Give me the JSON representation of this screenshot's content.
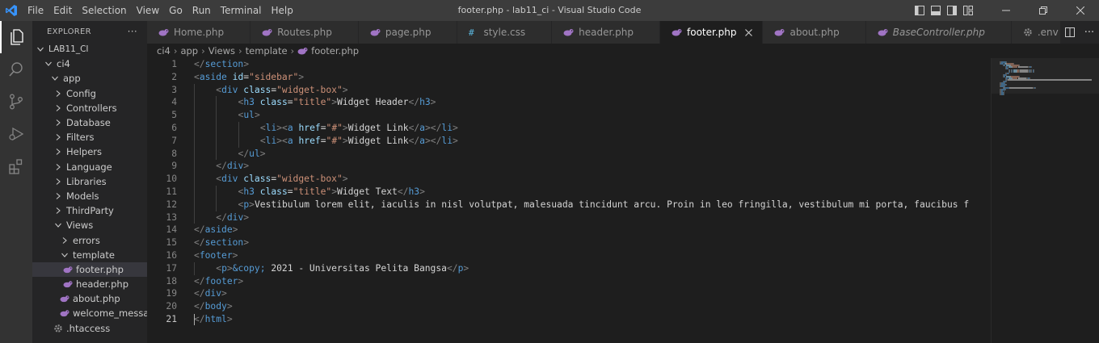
{
  "window": {
    "title": "footer.php - lab11_ci - Visual Studio Code",
    "menu": [
      "File",
      "Edit",
      "Selection",
      "View",
      "Go",
      "Run",
      "Terminal",
      "Help"
    ]
  },
  "explorer": {
    "header": "EXPLORER",
    "more": "···",
    "tree": [
      {
        "label": "LAB11_CI",
        "depth": 0,
        "kind": "folder-open"
      },
      {
        "label": "ci4",
        "depth": 1,
        "kind": "folder-open"
      },
      {
        "label": "app",
        "depth": 2,
        "kind": "folder-open"
      },
      {
        "label": "Config",
        "depth": 3,
        "kind": "folder"
      },
      {
        "label": "Controllers",
        "depth": 3,
        "kind": "folder"
      },
      {
        "label": "Database",
        "depth": 3,
        "kind": "folder"
      },
      {
        "label": "Filters",
        "depth": 3,
        "kind": "folder"
      },
      {
        "label": "Helpers",
        "depth": 3,
        "kind": "folder"
      },
      {
        "label": "Language",
        "depth": 3,
        "kind": "folder"
      },
      {
        "label": "Libraries",
        "depth": 3,
        "kind": "folder"
      },
      {
        "label": "Models",
        "depth": 3,
        "kind": "folder"
      },
      {
        "label": "ThirdParty",
        "depth": 3,
        "kind": "folder"
      },
      {
        "label": "Views",
        "depth": 3,
        "kind": "folder-open"
      },
      {
        "label": "errors",
        "depth": 4,
        "kind": "folder"
      },
      {
        "label": "template",
        "depth": 4,
        "kind": "folder-open"
      },
      {
        "label": "footer.php",
        "depth": 5,
        "kind": "php",
        "active": true
      },
      {
        "label": "header.php",
        "depth": 5,
        "kind": "php"
      },
      {
        "label": "about.php",
        "depth": 4,
        "kind": "php"
      },
      {
        "label": "welcome_messa...",
        "depth": 4,
        "kind": "php"
      },
      {
        "label": ".htaccess",
        "depth": 3,
        "kind": "gear"
      }
    ]
  },
  "tabs": [
    {
      "label": "Home.php",
      "icon": "php-icon",
      "active": false,
      "italic": false
    },
    {
      "label": "Routes.php",
      "icon": "php-icon",
      "active": false,
      "italic": false
    },
    {
      "label": "page.php",
      "icon": "php-icon",
      "active": false,
      "italic": false
    },
    {
      "label": "style.css",
      "icon": "css-icon",
      "active": false,
      "italic": false
    },
    {
      "label": "header.php",
      "icon": "php-icon",
      "active": false,
      "italic": false
    },
    {
      "label": "footer.php",
      "icon": "php-icon",
      "active": true,
      "italic": false
    },
    {
      "label": "about.php",
      "icon": "php-icon",
      "active": false,
      "italic": false
    },
    {
      "label": "BaseController.php",
      "icon": "php-icon",
      "active": false,
      "italic": true
    },
    {
      "label": ".env",
      "icon": "gear-icon",
      "active": false,
      "italic": false
    }
  ],
  "breadcrumb": [
    "ci4",
    "app",
    "Views",
    "template",
    "footer.php"
  ],
  "editor": {
    "current_line": 21,
    "lines": [
      {
        "n": 1,
        "indent": 0,
        "tokens": [
          [
            "br",
            "</"
          ],
          [
            "tag",
            "section"
          ],
          [
            "br",
            ">"
          ]
        ]
      },
      {
        "n": 2,
        "indent": 0,
        "tokens": [
          [
            "br",
            "<"
          ],
          [
            "tag",
            "aside"
          ],
          [
            "txt",
            " "
          ],
          [
            "attr",
            "id"
          ],
          [
            "txt",
            "="
          ],
          [
            "str",
            "\"sidebar\""
          ],
          [
            "br",
            ">"
          ]
        ]
      },
      {
        "n": 3,
        "indent": 1,
        "tokens": [
          [
            "br",
            "<"
          ],
          [
            "tag",
            "div"
          ],
          [
            "txt",
            " "
          ],
          [
            "attr",
            "class"
          ],
          [
            "txt",
            "="
          ],
          [
            "str",
            "\"widget-box\""
          ],
          [
            "br",
            ">"
          ]
        ]
      },
      {
        "n": 4,
        "indent": 2,
        "tokens": [
          [
            "br",
            "<"
          ],
          [
            "tag",
            "h3"
          ],
          [
            "txt",
            " "
          ],
          [
            "attr",
            "class"
          ],
          [
            "txt",
            "="
          ],
          [
            "str",
            "\"title\""
          ],
          [
            "br",
            ">"
          ],
          [
            "txt",
            "Widget Header"
          ],
          [
            "br",
            "</"
          ],
          [
            "tag",
            "h3"
          ],
          [
            "br",
            ">"
          ]
        ]
      },
      {
        "n": 5,
        "indent": 2,
        "tokens": [
          [
            "br",
            "<"
          ],
          [
            "tag",
            "ul"
          ],
          [
            "br",
            ">"
          ]
        ]
      },
      {
        "n": 6,
        "indent": 3,
        "tokens": [
          [
            "br",
            "<"
          ],
          [
            "tag",
            "li"
          ],
          [
            "br",
            "><"
          ],
          [
            "tag",
            "a"
          ],
          [
            "txt",
            " "
          ],
          [
            "attr",
            "href"
          ],
          [
            "txt",
            "="
          ],
          [
            "str",
            "\"#\""
          ],
          [
            "br",
            ">"
          ],
          [
            "txt",
            "Widget Link"
          ],
          [
            "br",
            "</"
          ],
          [
            "tag",
            "a"
          ],
          [
            "br",
            "></"
          ],
          [
            "tag",
            "li"
          ],
          [
            "br",
            ">"
          ]
        ]
      },
      {
        "n": 7,
        "indent": 3,
        "tokens": [
          [
            "br",
            "<"
          ],
          [
            "tag",
            "li"
          ],
          [
            "br",
            "><"
          ],
          [
            "tag",
            "a"
          ],
          [
            "txt",
            " "
          ],
          [
            "attr",
            "href"
          ],
          [
            "txt",
            "="
          ],
          [
            "str",
            "\"#\""
          ],
          [
            "br",
            ">"
          ],
          [
            "txt",
            "Widget Link"
          ],
          [
            "br",
            "</"
          ],
          [
            "tag",
            "a"
          ],
          [
            "br",
            "></"
          ],
          [
            "tag",
            "li"
          ],
          [
            "br",
            ">"
          ]
        ]
      },
      {
        "n": 8,
        "indent": 2,
        "tokens": [
          [
            "br",
            "</"
          ],
          [
            "tag",
            "ul"
          ],
          [
            "br",
            ">"
          ]
        ]
      },
      {
        "n": 9,
        "indent": 1,
        "tokens": [
          [
            "br",
            "</"
          ],
          [
            "tag",
            "div"
          ],
          [
            "br",
            ">"
          ]
        ]
      },
      {
        "n": 10,
        "indent": 1,
        "tokens": [
          [
            "br",
            "<"
          ],
          [
            "tag",
            "div"
          ],
          [
            "txt",
            " "
          ],
          [
            "attr",
            "class"
          ],
          [
            "txt",
            "="
          ],
          [
            "str",
            "\"widget-box\""
          ],
          [
            "br",
            ">"
          ]
        ]
      },
      {
        "n": 11,
        "indent": 2,
        "tokens": [
          [
            "br",
            "<"
          ],
          [
            "tag",
            "h3"
          ],
          [
            "txt",
            " "
          ],
          [
            "attr",
            "class"
          ],
          [
            "txt",
            "="
          ],
          [
            "str",
            "\"title\""
          ],
          [
            "br",
            ">"
          ],
          [
            "txt",
            "Widget Text"
          ],
          [
            "br",
            "</"
          ],
          [
            "tag",
            "h3"
          ],
          [
            "br",
            ">"
          ]
        ]
      },
      {
        "n": 12,
        "indent": 2,
        "tokens": [
          [
            "br",
            "<"
          ],
          [
            "tag",
            "p"
          ],
          [
            "br",
            ">"
          ],
          [
            "txt",
            "Vestibulum lorem elit, iaculis in nisl volutpat, malesuada tincidunt arcu. Proin in leo fringilla, vestibulum mi porta, faucibus f"
          ]
        ]
      },
      {
        "n": 13,
        "indent": 1,
        "tokens": [
          [
            "br",
            "</"
          ],
          [
            "tag",
            "div"
          ],
          [
            "br",
            ">"
          ]
        ]
      },
      {
        "n": 14,
        "indent": 0,
        "tokens": [
          [
            "br",
            "</"
          ],
          [
            "tag",
            "aside"
          ],
          [
            "br",
            ">"
          ]
        ]
      },
      {
        "n": 15,
        "indent": 0,
        "tokens": [
          [
            "br",
            "</"
          ],
          [
            "tag",
            "section"
          ],
          [
            "br",
            ">"
          ]
        ]
      },
      {
        "n": 16,
        "indent": 0,
        "tokens": [
          [
            "br",
            "<"
          ],
          [
            "tag",
            "footer"
          ],
          [
            "br",
            ">"
          ]
        ]
      },
      {
        "n": 17,
        "indent": 1,
        "tokens": [
          [
            "br",
            "<"
          ],
          [
            "tag",
            "p"
          ],
          [
            "br",
            ">"
          ],
          [
            "ent",
            "&copy;"
          ],
          [
            "txt",
            " 2021 - Universitas Pelita Bangsa"
          ],
          [
            "br",
            "</"
          ],
          [
            "tag",
            "p"
          ],
          [
            "br",
            ">"
          ]
        ]
      },
      {
        "n": 18,
        "indent": 0,
        "tokens": [
          [
            "br",
            "</"
          ],
          [
            "tag",
            "footer"
          ],
          [
            "br",
            ">"
          ]
        ]
      },
      {
        "n": 19,
        "indent": 0,
        "tokens": [
          [
            "br",
            "</"
          ],
          [
            "tag",
            "div"
          ],
          [
            "br",
            ">"
          ]
        ]
      },
      {
        "n": 20,
        "indent": 0,
        "tokens": [
          [
            "br",
            "</"
          ],
          [
            "tag",
            "body"
          ],
          [
            "br",
            ">"
          ]
        ]
      },
      {
        "n": 21,
        "indent": 0,
        "tokens": [
          [
            "br",
            "</"
          ],
          [
            "tag",
            "html"
          ],
          [
            "br",
            ">"
          ]
        ]
      }
    ]
  },
  "colors": {
    "tag": "#569cd6",
    "bracket": "#808080",
    "attribute": "#9cdcfe",
    "string": "#ce9178",
    "text": "#d4d4d4",
    "php_icon": "#a074c4",
    "css_icon": "#519aba"
  }
}
